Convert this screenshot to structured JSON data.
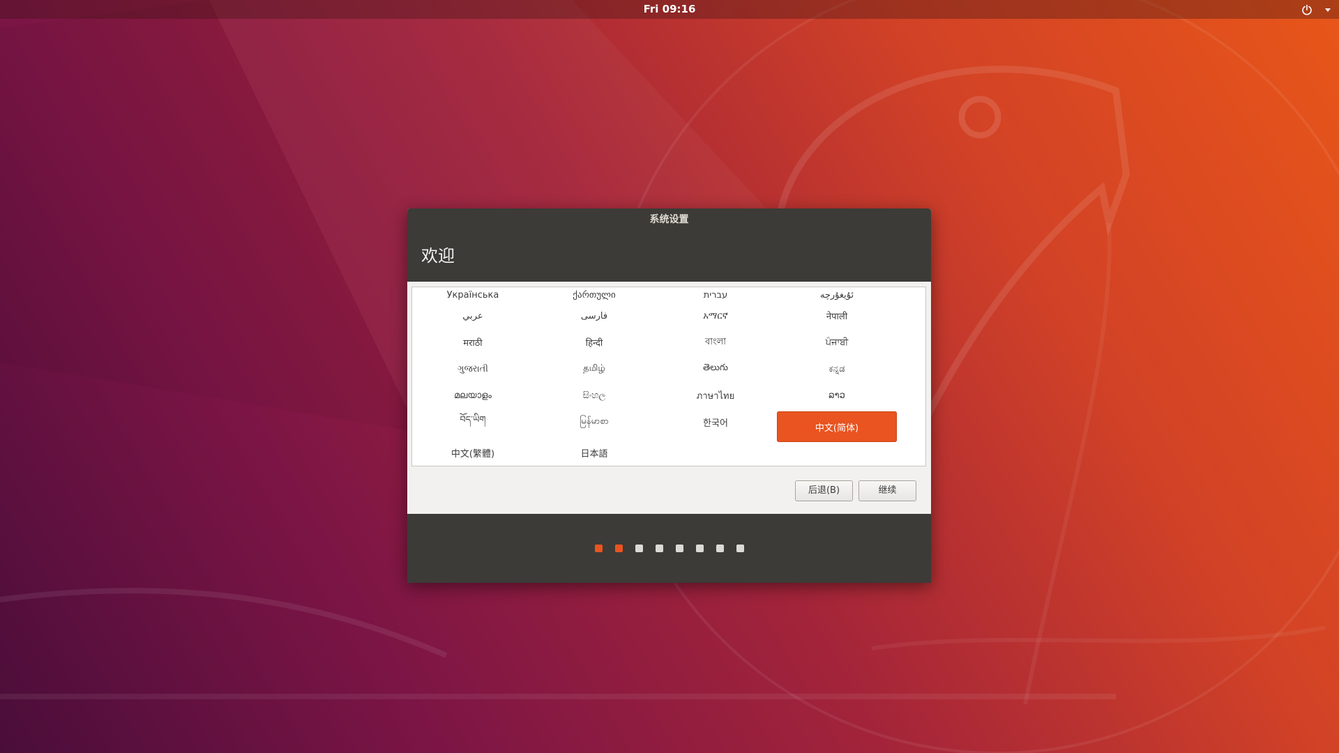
{
  "topbar": {
    "clock": "Fri 09:16",
    "power_icon": "power-icon",
    "menu_icon": "chevron-down-icon"
  },
  "dialog": {
    "title": "系统设置",
    "heading": "欢迎",
    "languages": [
      "Українська",
      "ქართული",
      "עברית",
      "ئۇيغۇرچە",
      "عربي",
      "فارسی",
      "አማርኛ",
      "नेपाली",
      "मराठी",
      "हिन्दी",
      "বাংলা",
      "ਪੰਜਾਬੀ",
      "ગુજરાતી",
      "தமிழ்",
      "తెలుగు",
      "ಕನ್ನಡ",
      "മലയാളം",
      "සිංහල",
      "ภาษาไทย",
      "ລາວ",
      "བོད་ཡིག",
      "မြန်မာစာ",
      "한국어",
      "中文(简体)",
      "中文(繁體)",
      "日本語"
    ],
    "selected_language": "中文(简体)",
    "back_label": "后退(B)",
    "continue_label": "继续",
    "progress": {
      "total_steps": 8,
      "completed_steps": 2
    }
  },
  "colors": {
    "accent": "#e95420",
    "dialog_dark": "#3c3b37",
    "dialog_light": "#f2f1f0"
  }
}
